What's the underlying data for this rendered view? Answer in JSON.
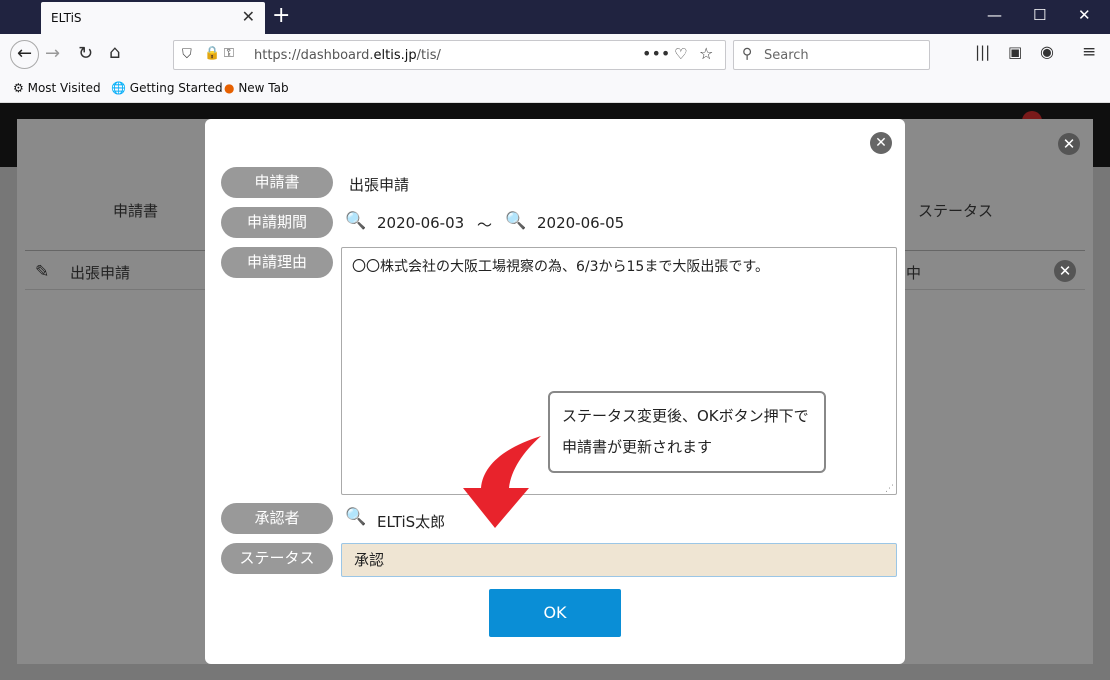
{
  "browser": {
    "tab_title": "ELTiS",
    "url_prefix": "https://dashboard.",
    "url_domain": "eltis.jp",
    "url_suffix": "/tis/",
    "search_placeholder": "Search",
    "bookmarks": [
      "Most Visited",
      "Getting Started",
      "New Tab"
    ]
  },
  "background": {
    "columns": [
      "申請書",
      "ステータス"
    ],
    "row_name": "出張申請",
    "row_status_fragment": "中"
  },
  "modal": {
    "labels": {
      "form": "申請書",
      "period": "申請期間",
      "reason": "申請理由",
      "approver": "承認者",
      "status": "ステータス"
    },
    "form_value": "出張申請",
    "period_start": "2020-06-03",
    "period_sep": "〜",
    "period_end": "2020-06-05",
    "reason_text": "〇〇株式会社の大阪工場視察の為、6/3から15まで大阪出張です。",
    "approver_value": "ELTiS太郎",
    "status_value": "承認",
    "ok_label": "OK",
    "tooltip_line1": "ステータス変更後、OKボタン押下で",
    "tooltip_line2": "申請書が更新されます"
  },
  "colors": {
    "ok_button": "#0a8ed6",
    "arrow": "#e8232c",
    "status_bg": "#efe5d3",
    "pill": "#999999"
  }
}
